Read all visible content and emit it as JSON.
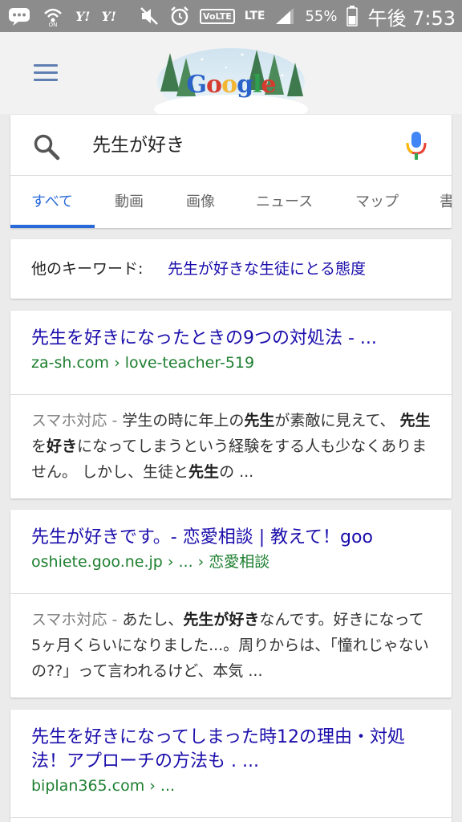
{
  "status_bar": {
    "yahoo_1": "Y!",
    "yahoo_2": "Y!",
    "volte": "VoLTE",
    "lte": "LTE",
    "battery": "55%",
    "time": "午後 7:53"
  },
  "header": {
    "doodle_text": "Google"
  },
  "search": {
    "query": "先生が好き"
  },
  "tabs": [
    {
      "label": "すべて",
      "active": true
    },
    {
      "label": "動画"
    },
    {
      "label": "画像"
    },
    {
      "label": "ニュース"
    },
    {
      "label": "マップ"
    },
    {
      "label": "書"
    }
  ],
  "related": {
    "prefix": "他のキーワード:",
    "link": "先生が好きな生徒にとる態度"
  },
  "results": [
    {
      "title": "先生を好きになったときの9つの対処法 - ...",
      "url": "za-sh.com › love-teacher-519",
      "snippet_tag": "スマホ対応 - ",
      "snippet_parts": [
        "学生の時に年上の",
        "先生",
        "が素敵に見えて、 ",
        "先生",
        "を",
        "好き",
        "になってしまうという経験をする人も少なくありません。 しかし、生徒と",
        "先生",
        "の ..."
      ]
    },
    {
      "title": "先生が好きです。- 恋愛相談 | 教えて！goo",
      "url": "oshiete.goo.ne.jp › ... › 恋愛相談",
      "snippet_tag": "スマホ対応 - ",
      "snippet_parts": [
        "あたし、",
        "先生が好き",
        "なんです。好きになって5ヶ月くらいになりました...。周りからは、「憧れじゃないの??」って言われるけど、本気 ..."
      ]
    },
    {
      "title": "先生を好きになってしまった時12の理由・対処法！アプローチの方法も . ...",
      "url": "biplan365.com › ..."
    }
  ]
}
